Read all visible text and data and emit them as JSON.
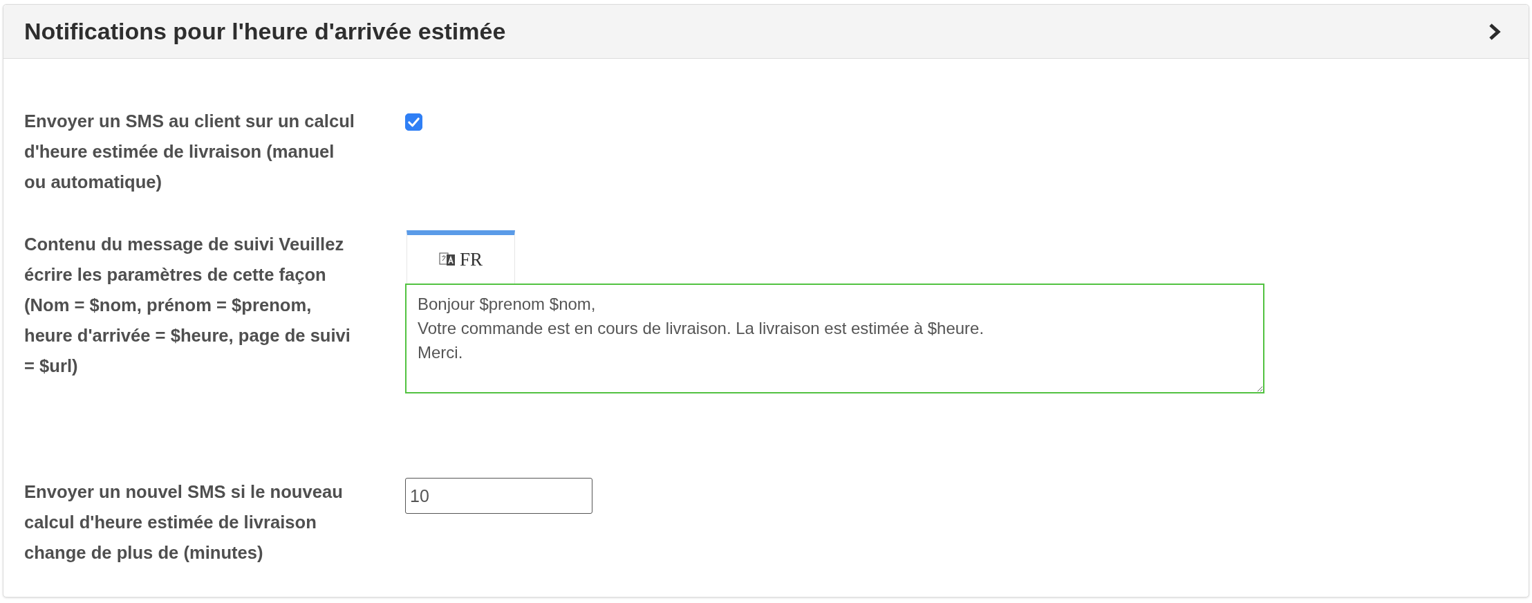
{
  "panel": {
    "title": "Notifications pour l'heure d'arrivée estimée",
    "expanded": false,
    "fields": [
      {
        "kind": "checkbox",
        "label": "Envoyer un SMS au client sur un calcul d'heure estimée de livraison (manuel ou automatique)",
        "checked": true
      },
      {
        "kind": "textarea",
        "label": "Contenu du message de suivi Veuillez écrire les paramètres de cette façon (Nom = $nom, prénom = $prenom, heure d'arrivée = $heure, page de suivi = $url)",
        "tabs": [
          {
            "label": "FR",
            "selected": true
          }
        ],
        "value": "Bonjour $prenom $nom,\nVotre commande est en cours de livraison. La livraison est estimée à $heure.\nMerci.",
        "valid": true
      },
      {
        "kind": "number",
        "label": "Envoyer un nouvel SMS si le nouveau calcul d'heure estimée de livraison change de plus de (minutes)",
        "value": "10"
      }
    ]
  }
}
